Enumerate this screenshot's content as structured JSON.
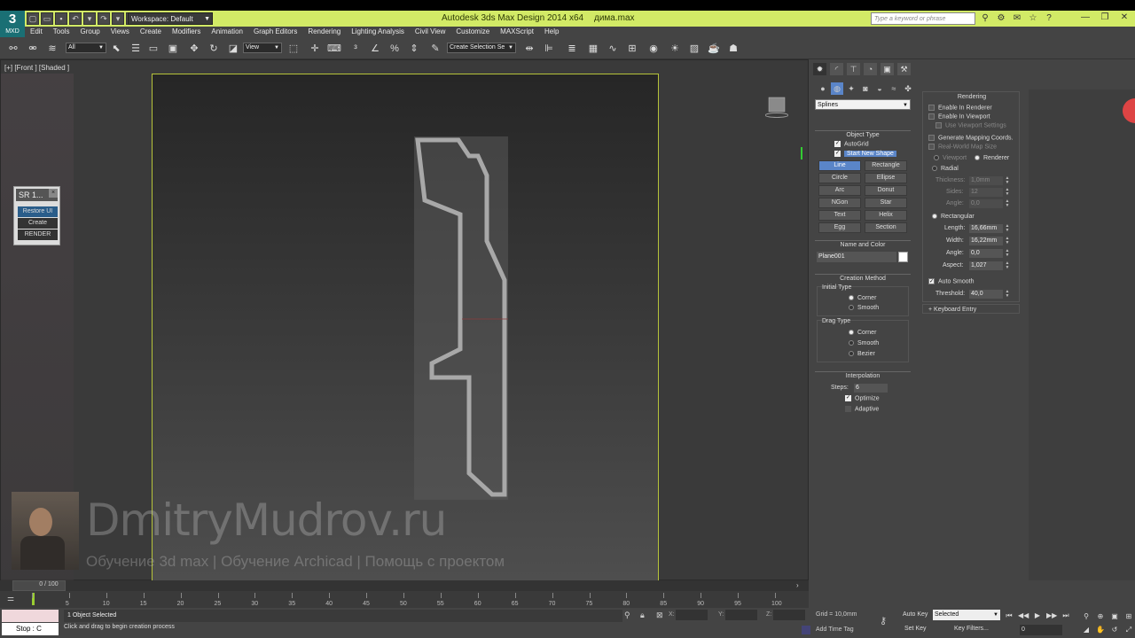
{
  "titlebar": {
    "workspace_label": "Workspace: Default",
    "app_title": "Autodesk 3ds Max Design 2014 x64",
    "file_name": "дима.max",
    "search_placeholder": "Type a keyword or phrase",
    "logo_text": "MXD"
  },
  "menubar": {
    "items": [
      "Edit",
      "Tools",
      "Group",
      "Views",
      "Create",
      "Modifiers",
      "Animation",
      "Graph Editors",
      "Rendering",
      "Lighting Analysis",
      "Civil View",
      "Customize",
      "MAXScript",
      "Help"
    ]
  },
  "toolbar": {
    "selection_filter": "All",
    "reference_coord": "View",
    "named_selection": "Create Selection Se"
  },
  "viewport": {
    "label": "[+] [Front ] [Shaded ]"
  },
  "sr_panel": {
    "title": "SR 1...",
    "buttons": [
      "Restore UI",
      "Create",
      "RENDER"
    ]
  },
  "watermark": {
    "title": "DmitryMudrov.ru",
    "subtitle": "Обучение 3d max | Обучение Archicad | Помощь с проектом"
  },
  "command_panel": {
    "category": "Splines",
    "object_type_title": "Object Type",
    "autogrid_label": "AutoGrid",
    "start_new_shape_label": "Start New Shape",
    "object_types": [
      "Line",
      "Rectangle",
      "Circle",
      "Ellipse",
      "Arc",
      "Donut",
      "NGon",
      "Star",
      "Text",
      "Helix",
      "Egg",
      "Section"
    ],
    "name_color_title": "Name and Color",
    "object_name": "Plane001",
    "creation_method_title": "Creation Method",
    "initial_type_label": "Initial Type",
    "initial_type_options": [
      "Corner",
      "Smooth"
    ],
    "drag_type_label": "Drag Type",
    "drag_type_options": [
      "Corner",
      "Smooth",
      "Bezier"
    ],
    "interpolation_title": "Interpolation",
    "steps_label": "Steps:",
    "steps_value": "6",
    "optimize_label": "Optimize",
    "adaptive_label": "Adaptive"
  },
  "rendering_panel": {
    "title": "Rendering",
    "enable_renderer": "Enable In Renderer",
    "enable_viewport": "Enable In Viewport",
    "use_viewport_settings": "Use Viewport Settings",
    "generate_mapping": "Generate Mapping Coords.",
    "real_world": "Real-World Map Size",
    "viewport_label": "Viewport",
    "renderer_label": "Renderer",
    "radial_label": "Radial",
    "thickness_label": "Thickness:",
    "thickness_value": "1,0mm",
    "sides_label": "Sides:",
    "sides_value": "12",
    "angle_label": "Angle:",
    "angle_value": "0,0",
    "rectangular_label": "Rectangular",
    "length_label": "Length:",
    "length_value": "16,66mm",
    "width_label": "Width:",
    "width_value": "16,22mm",
    "rect_angle_label": "Angle:",
    "rect_angle_value": "0,0",
    "aspect_label": "Aspect:",
    "aspect_value": "1,027",
    "auto_smooth_label": "Auto Smooth",
    "threshold_label": "Threshold:",
    "threshold_value": "40,0",
    "keyboard_entry": "Keyboard Entry"
  },
  "timeline": {
    "frame_display": "0 / 100",
    "ticks": [
      "0",
      "5",
      "10",
      "15",
      "20",
      "25",
      "30",
      "35",
      "40",
      "45",
      "50",
      "55",
      "60",
      "65",
      "70",
      "75",
      "80",
      "85",
      "90",
      "95",
      "100"
    ]
  },
  "status": {
    "stop_label": "Stop : C",
    "selection": "1 Object Selected",
    "prompt": "Click and drag to begin creation process",
    "x_label": "X:",
    "y_label": "Y:",
    "z_label": "Z:",
    "grid": "Grid = 10,0mm",
    "add_time_tag": "Add Time Tag",
    "auto_key": "Auto Key",
    "set_key": "Set Key",
    "key_mode": "Selected",
    "key_filters": "Key Filters...",
    "current_frame": "0"
  }
}
